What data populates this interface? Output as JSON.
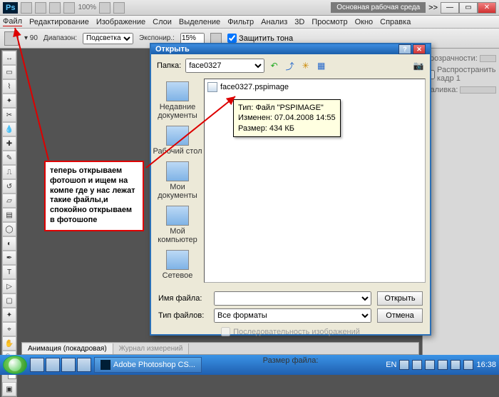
{
  "titlebar": {
    "app_badge": "Ps",
    "zoom": "100%",
    "workspace": "Основная рабочая среда",
    "chevrons": ">>"
  },
  "menubar": [
    "Файл",
    "Редактирование",
    "Изображение",
    "Слои",
    "Выделение",
    "Фильтр",
    "Анализ",
    "3D",
    "Просмотр",
    "Окно",
    "Справка"
  ],
  "options": {
    "range_label": "Диапазон:",
    "range_value": "Подсветка",
    "exposure_label": "Экспонир.:",
    "exposure_value": "15%",
    "protect": "Защитить тона"
  },
  "annotation": "теперь открываем фотошоп и ищем на компе где у нас лежат такие файлы,и спокойно открываем в фотошопе",
  "dialog": {
    "title": "Открыть",
    "folder_label": "Папка:",
    "folder_value": "face0327",
    "places": [
      "Недавние документы",
      "Рабочий стол",
      "Мои документы",
      "Мой компьютер",
      "Сетевое"
    ],
    "file_name": "face0327.pspimage",
    "tooltip_l1": "Тип: Файл \"PSPIMAGE\"",
    "tooltip_l2": "Изменен: 07.04.2008 14:55",
    "tooltip_l3": "Размер: 434 КБ",
    "filename_label": "Имя файла:",
    "filename_value": "",
    "filetype_label": "Тип файлов:",
    "filetype_value": "Все форматы",
    "open_btn": "Открыть",
    "cancel_btn": "Отмена",
    "sequence": "Последовательность изображений",
    "size_label": "Размер файла:"
  },
  "rightpanel": {
    "opacity": "прозрачности:",
    "propagate": "Распространить кадр 1",
    "fill": "Заливка:"
  },
  "timeline": {
    "tab1": "Анимация (покадровая)",
    "tab2": "Журнал измерений"
  },
  "taskbar": {
    "task": "Adobe Photoshop CS...",
    "lang": "EN",
    "time": "16:38"
  }
}
